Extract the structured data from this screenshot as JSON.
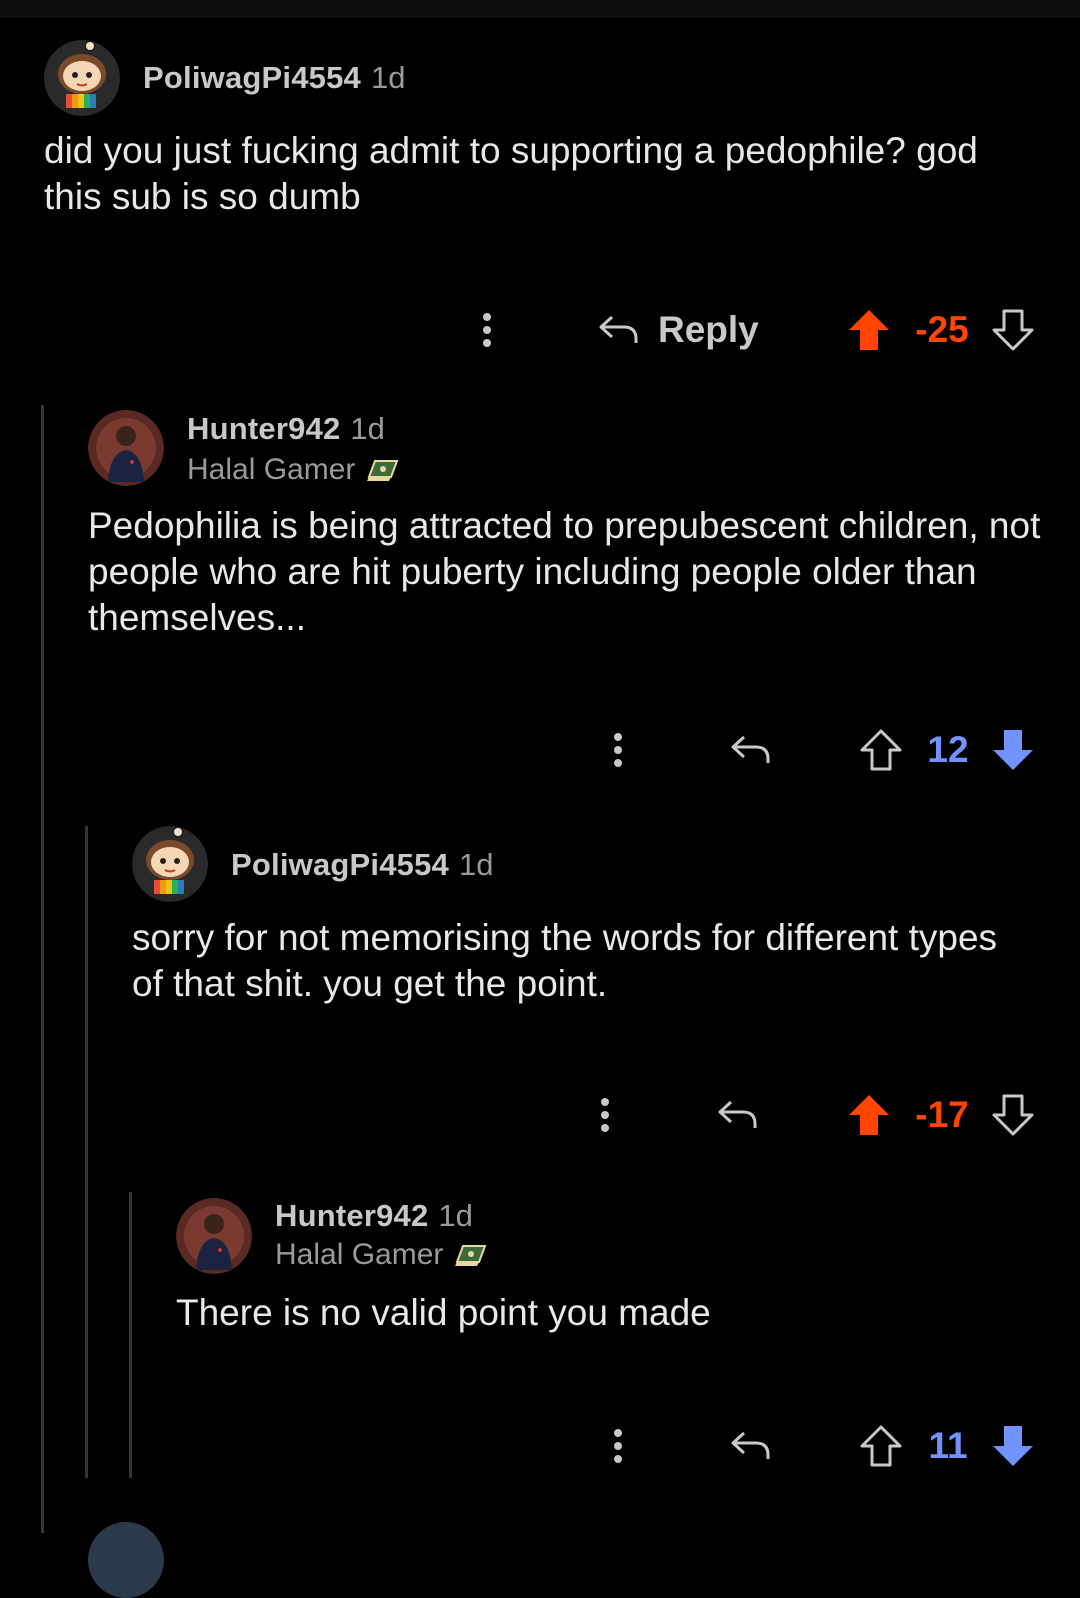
{
  "colors": {
    "upvoted": "#ff4500",
    "downvoted": "#7193ff",
    "muted": "#9a9a9a"
  },
  "comments": [
    {
      "username": "PoliwagPi4554",
      "age": "1d",
      "flair": "",
      "body": "did you just fucking admit to supporting a pedophile? god this sub is so dumb",
      "reply_label": "Reply",
      "score": "-25",
      "vote_state": "upvoted",
      "avatar": "snoo-avatar-icon"
    },
    {
      "username": "Hunter942",
      "age": "1d",
      "flair": "Halal Gamer",
      "flair_icon": "book-icon",
      "body": "Pedophilia is being attracted to prepubescent children, not people who are hit puberty including people older than themselves...",
      "score": "12",
      "vote_state": "downvoted",
      "avatar": "photo-avatar-icon"
    },
    {
      "username": "PoliwagPi4554",
      "age": "1d",
      "flair": "",
      "body": "sorry for not memorising the words for different types of that shit. you get the point.",
      "score": "-17",
      "vote_state": "upvoted",
      "avatar": "snoo-avatar-icon"
    },
    {
      "username": "Hunter942",
      "age": "1d",
      "flair": "Halal Gamer",
      "flair_icon": "book-icon",
      "body": "There is no valid point you made",
      "score": "11",
      "vote_state": "downvoted",
      "avatar": "photo-avatar-icon"
    }
  ]
}
